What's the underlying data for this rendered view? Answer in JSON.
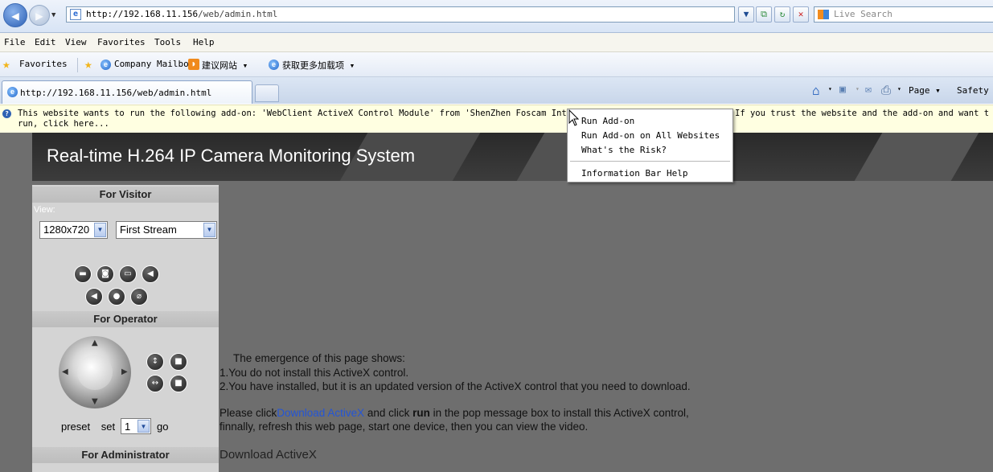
{
  "browser": {
    "address": {
      "url_host": "http://192.168.11.156",
      "url_path": "/web/admin.html"
    },
    "search_placeholder": "Live Search",
    "menu": [
      "File",
      "Edit",
      "View",
      "Favorites",
      "Tools",
      "Help"
    ],
    "favorites": {
      "label": "Favorites",
      "items": [
        "Company Mailbox",
        "建议网站 ▾",
        "获取更多加载项 ▾"
      ]
    },
    "tab": {
      "title": "http://192.168.11.156/web/admin.html"
    },
    "commands": {
      "page": "Page ▾",
      "safety": "Safety"
    }
  },
  "infobar": {
    "line1": "This website wants to run the following add-on: 'WebClient ActiveX Control Module' from 'ShenZhen Foscam Int",
    "line1_tail": "If you trust the website and the add-on and want t",
    "line2": "run, click here..."
  },
  "context_menu": {
    "items": [
      "Run Add-on",
      "Run Add-on on All Websites",
      "What's the Risk?",
      "Information Bar Help"
    ]
  },
  "page": {
    "title": "Real-time H.264 IP Camera Monitoring System",
    "visitor": {
      "header": "For Visitor",
      "view_label": "View:",
      "resolution": "1280x720",
      "stream": "First Stream"
    },
    "operator": {
      "header": "For Operator",
      "preset_label": "preset",
      "set_label": "set",
      "preset_value": "1",
      "go_label": "go"
    },
    "admin_header": "For Administrator",
    "message": {
      "line1": "The emergence of this page shows:",
      "line2": "1.You do not install this ActiveX control.",
      "line3": "2.You have installed, but it is an updated version of the ActiveX control that you need to download.",
      "line4_pre": "Please click",
      "line4_link": "Download ActiveX",
      "line4_mid": " and click ",
      "line4_bold": "run",
      "line4_post": " in the pop message box to install this ActiveX control,",
      "line5": "finnally, refresh this web page, start one device, then you can view the video.",
      "download_link": "Download ActiveX"
    }
  }
}
